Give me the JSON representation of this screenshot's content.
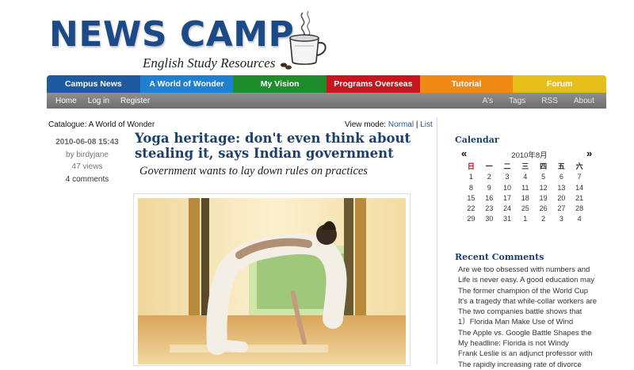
{
  "site": {
    "title": "NEWS CAMP",
    "subtitle": "English Study Resources"
  },
  "nav": {
    "tabs": [
      {
        "label": "Campus News",
        "color": "#1f5aa0"
      },
      {
        "label": "A World of Wonder",
        "color": "#1f7fd0"
      },
      {
        "label": "My Vision",
        "color": "#1f8c2c"
      },
      {
        "label": "Programs Overseas",
        "color": "#c9141f"
      },
      {
        "label": "Tutorial",
        "color": "#f08a14"
      },
      {
        "label": "Forum",
        "color": "#e5c01b"
      }
    ]
  },
  "subnav": {
    "left": [
      "Home",
      "Log in",
      "Register"
    ],
    "right": [
      "A's",
      "Tags",
      "RSS",
      "About"
    ]
  },
  "catalogue": {
    "text": "Catalogue: A World of Wonder",
    "view_mode_label": "View mode: ",
    "normal": "Normal",
    "sep": " | ",
    "list": "List"
  },
  "post": {
    "datetime": "2010-06-08 15:43",
    "author": "by birdyjane",
    "views": "47 views",
    "comments": "4 comments",
    "title": "Yoga heritage: don't even think about stealing it, says Indian government",
    "subtitle": "Government wants to lay down rules on practices"
  },
  "calendar": {
    "heading": "Calendar",
    "prev": "«",
    "next": "»",
    "month": "2010年8月",
    "weekdays": [
      "日",
      "一",
      "二",
      "三",
      "四",
      "五",
      "六"
    ],
    "weeks": [
      [
        "1",
        "2",
        "3",
        "4",
        "5",
        "6",
        "7"
      ],
      [
        "8",
        "9",
        "10",
        "11",
        "12",
        "13",
        "14"
      ],
      [
        "15",
        "16",
        "17",
        "18",
        "19",
        "20",
        "21"
      ],
      [
        "22",
        "23",
        "24",
        "25",
        "26",
        "27",
        "28"
      ],
      [
        "29",
        "30",
        "31",
        "1",
        "2",
        "3",
        "4"
      ]
    ]
  },
  "recent_comments": {
    "heading": "Recent Comments",
    "items": [
      "Are we too obsessed with numbers and",
      "Life is never easy. A good education may",
      "The former champion of the World Cup",
      "It's a tragedy that while-collar workers are",
      "The two companies battle shows that",
      "1）Florida Man Make Use of Wind",
      "The Apple vs. Google Battle Shapes the",
      "My headline: Florida is not Windy",
      "Frank Leslie is an adjunct professor with",
      "The rapidly increasing rate of divorce"
    ]
  }
}
